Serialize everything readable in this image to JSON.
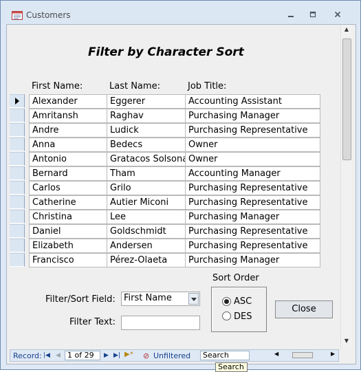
{
  "window": {
    "title": "Customers"
  },
  "form": {
    "title": "Filter by Character Sort",
    "columns": [
      "First Name:",
      "Last Name:",
      "Job Title:"
    ],
    "rows": [
      [
        "Alexander",
        "Eggerer",
        "Accounting Assistant"
      ],
      [
        "Amritansh",
        "Raghav",
        "Purchasing Manager"
      ],
      [
        "Andre",
        "Ludick",
        "Purchasing Representative"
      ],
      [
        "Anna",
        "Bedecs",
        "Owner"
      ],
      [
        "Antonio",
        "Gratacos Solsona",
        "Owner"
      ],
      [
        "Bernard",
        "Tham",
        "Accounting Manager"
      ],
      [
        "Carlos",
        "Grilo",
        "Purchasing Representative"
      ],
      [
        "Catherine",
        "Autier Miconi",
        "Purchasing Representative"
      ],
      [
        "Christina",
        "Lee",
        "Purchasing Manager"
      ],
      [
        "Daniel",
        "Goldschmidt",
        "Purchasing Representative"
      ],
      [
        "Elizabeth",
        "Andersen",
        "Purchasing Representative"
      ],
      [
        "Francisco",
        "Pérez-Olaeta",
        "Purchasing Manager"
      ]
    ],
    "filter_sort_label": "Filter/Sort Field:",
    "filter_sort_value": "First Name",
    "filter_text_label": "Filter Text:",
    "filter_text_value": "",
    "sort_order_label": "Sort Order",
    "sort_asc_label": "ASC",
    "sort_des_label": "DES",
    "sort_selected": "ASC",
    "close_label": "Close"
  },
  "navigator": {
    "record_label": "Record:",
    "record_value": "1 of 29",
    "filter_status": "Unfiltered",
    "search_value": "Search"
  },
  "tooltip": {
    "text": "Search"
  }
}
